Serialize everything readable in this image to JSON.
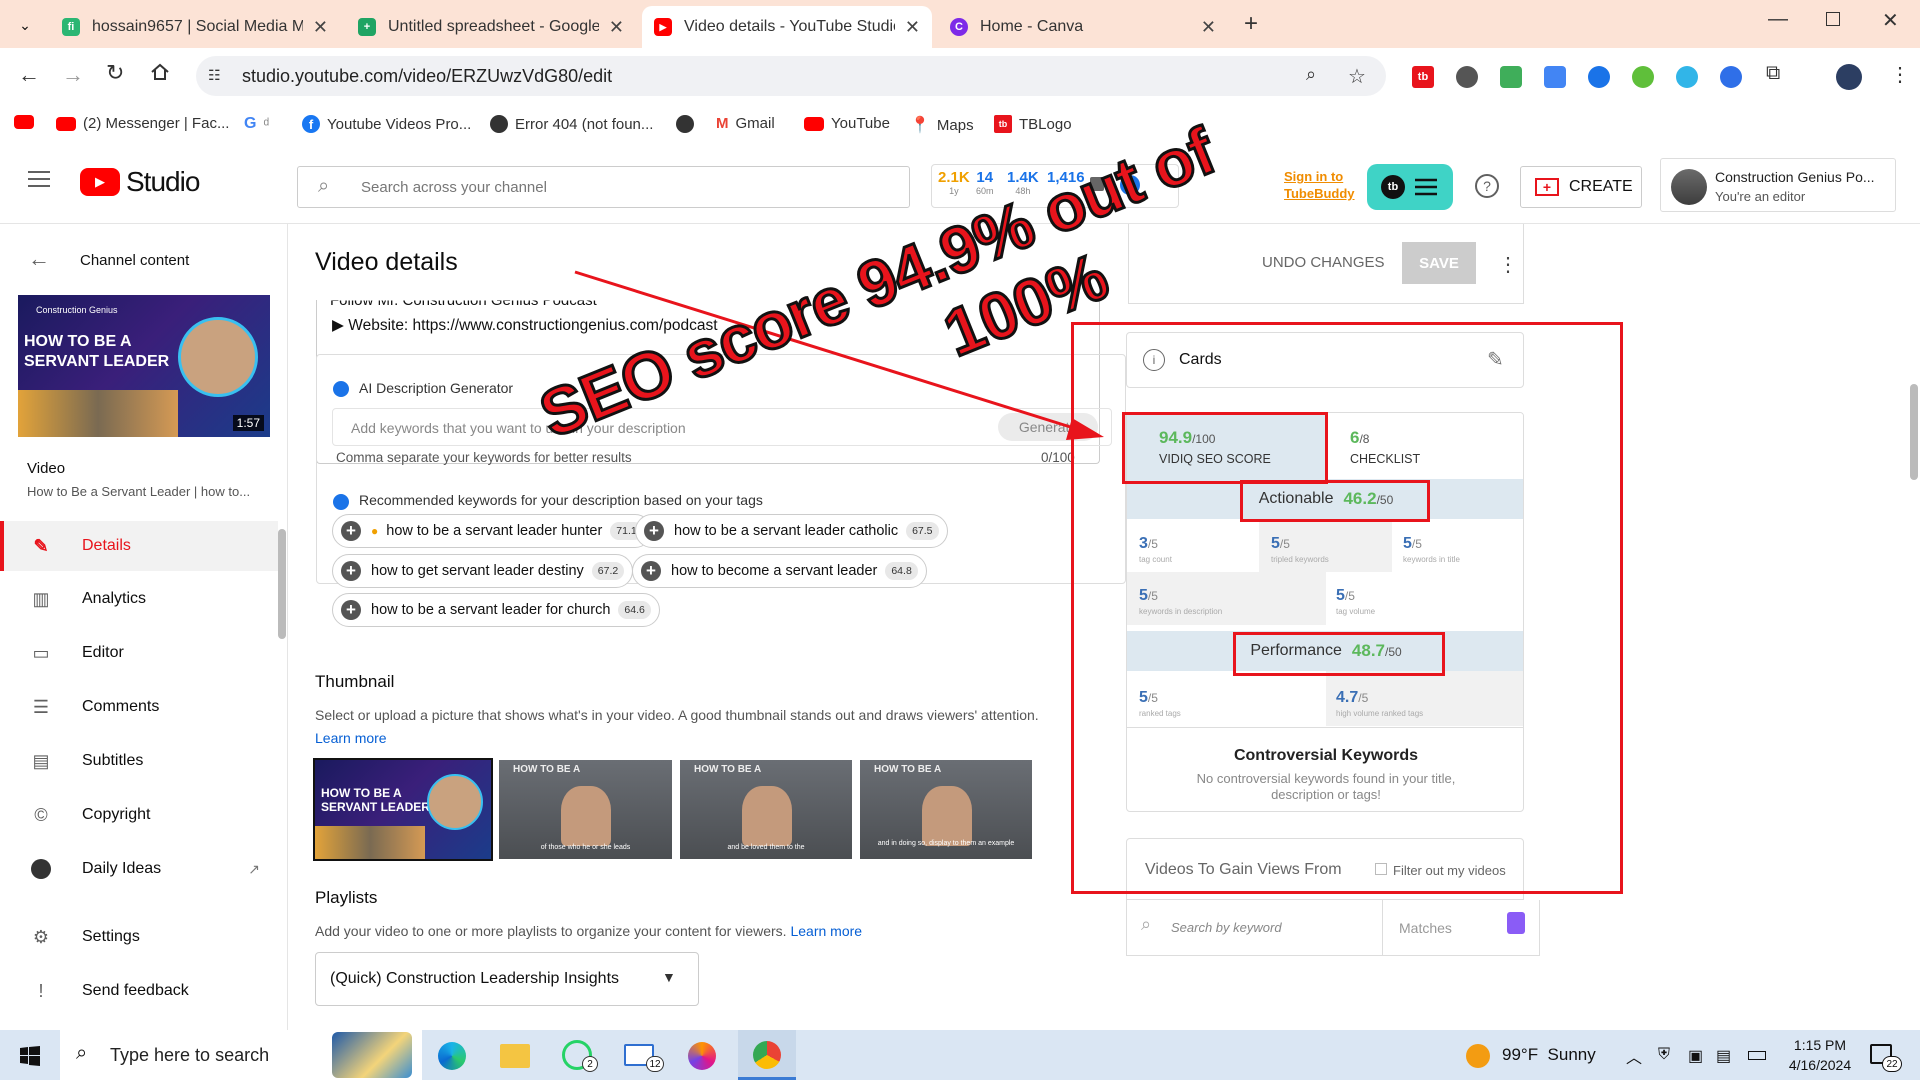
{
  "browser": {
    "tabs": [
      {
        "title": "hossain9657 | Social Media Ma",
        "color": "#2bb673",
        "glyph": "fi"
      },
      {
        "title": "Untitled spreadsheet - Google S",
        "color": "#1fa463",
        "glyph": "+"
      },
      {
        "title": "Video details - YouTube Studio",
        "color": "#ff0000",
        "glyph": "▶"
      },
      {
        "title": "Home - Canva",
        "color": "#7d2ae8",
        "glyph": "C"
      }
    ],
    "url": "studio.youtube.com/video/ERZUwzVdG80/edit",
    "bookmarks": [
      "(2) Messenger | Fac...",
      "Youtube Videos Pro...",
      "Error 404 (not foun...",
      "Gmail",
      "YouTube",
      "Maps",
      "TBLogo"
    ]
  },
  "studio": {
    "logo": "Studio",
    "search_placeholder": "Search across your channel",
    "stats": [
      {
        "value": "2.1K",
        "sub": "1y",
        "color": "#f0a000"
      },
      {
        "value": "14",
        "sub": "60m",
        "color": "#1a73e8"
      },
      {
        "value": "1.4K",
        "sub": "48h",
        "color": "#1a73e8"
      },
      {
        "value": "1,416",
        "sub": "",
        "color": "#1a73e8"
      }
    ],
    "signin_line1": "Sign in to",
    "signin_line2": "TubeBuddy",
    "create": "CREATE",
    "account_name": "Construction Genius Po...",
    "account_role": "You're an editor"
  },
  "sidebar": {
    "back_label": "Channel content",
    "thumb_title_1": "HOW TO BE A",
    "thumb_title_2": "SERVANT LEADER",
    "thumb_brand": "Construction Genius",
    "duration": "1:57",
    "video_heading": "Video",
    "video_title": "How to Be a Servant Leader | how to...",
    "items": [
      "Details",
      "Analytics",
      "Editor",
      "Comments",
      "Subtitles",
      "Copyright",
      "Daily Ideas"
    ],
    "settings": "Settings",
    "feedback": "Send feedback"
  },
  "page": {
    "title": "Video details",
    "undo": "UNDO CHANGES",
    "save": "SAVE"
  },
  "description": {
    "cut_line": "Follow Mr. Construction Genius Podcast",
    "website": "▶ Website: https://www.constructiongenius.com/podcast",
    "ai_label": "AI Description Generator",
    "ai_placeholder": "Add keywords that you want to use in your description",
    "generate": "Generate",
    "hint": "Comma separate your keywords for better results",
    "counter": "0/100",
    "rec_label": "Recommended keywords for your description based on your tags",
    "chips": [
      {
        "text": "how to be a servant leader hunter",
        "score": "71.1"
      },
      {
        "text": "how to be a servant leader catholic",
        "score": "67.5"
      },
      {
        "text": "how to get servant leader destiny",
        "score": "67.2"
      },
      {
        "text": "how to become a servant leader",
        "score": "64.8"
      },
      {
        "text": "how to be a servant leader for church",
        "score": "64.6"
      }
    ]
  },
  "thumbnail": {
    "heading": "Thumbnail",
    "desc": "Select or upload a picture that shows what's in your video. A good thumbnail stands out and draws viewers' attention.",
    "learn_more": "Learn more",
    "frames": [
      "HOW TO BE A",
      "HOW TO BE A",
      "HOW TO BE A"
    ],
    "captions": [
      "of those who he or she leads",
      "and be loved them to the",
      "and in doing so, display to them an example"
    ]
  },
  "playlists": {
    "heading": "Playlists",
    "desc": "Add your video to one or more playlists to organize your content for viewers.",
    "learn_more": "Learn more",
    "selected": "(Quick) Construction Leadership Insights"
  },
  "right": {
    "cards": "Cards",
    "seo_score": "94.9",
    "seo_max": "/100",
    "seo_label": "VIDIQ SEO SCORE",
    "checklist_score": "6",
    "checklist_max": "/8",
    "checklist_label": "CHECKLIST",
    "actionable_label": "Actionable",
    "actionable_score": "46.2",
    "actionable_max": "/50",
    "actionable_cells": [
      {
        "v": "3",
        "m": "/5",
        "l": "tag count"
      },
      {
        "v": "5",
        "m": "/5",
        "l": "tripled keywords"
      },
      {
        "v": "5",
        "m": "/5",
        "l": "keywords in title"
      },
      {
        "v": "5",
        "m": "/5",
        "l": "keywords in description"
      },
      {
        "v": "5",
        "m": "/5",
        "l": "tag volume"
      }
    ],
    "performance_label": "Performance",
    "performance_score": "48.7",
    "performance_max": "/50",
    "performance_cells": [
      {
        "v": "5",
        "m": "/5",
        "l": "ranked tags"
      },
      {
        "v": "4.7",
        "m": "/5",
        "l": "high volume ranked tags"
      }
    ],
    "controversial_title": "Controversial Keywords",
    "controversial_text_1": "No controversial keywords found in your title,",
    "controversial_text_2": "description or tags!",
    "gain_label": "Videos To Gain Views From",
    "filter_label": "Filter out my videos",
    "search_kw": "Search by keyword",
    "matches": "Matches"
  },
  "overlay": {
    "line1": "SEO score 94.9% out of",
    "line2": "100%"
  },
  "taskbar": {
    "search": "Type here to search",
    "weather": "99°F  Sunny",
    "time": "1:15 PM",
    "date": "4/16/2024",
    "notif": "22",
    "whatsapp_badge": "2",
    "mail_badge": "12"
  },
  "colors": {
    "accent_red": "#e8141c",
    "vidiq_green": "#5cb85c",
    "tb_teal": "#3fd3c6",
    "yt_red": "#ff0000"
  }
}
